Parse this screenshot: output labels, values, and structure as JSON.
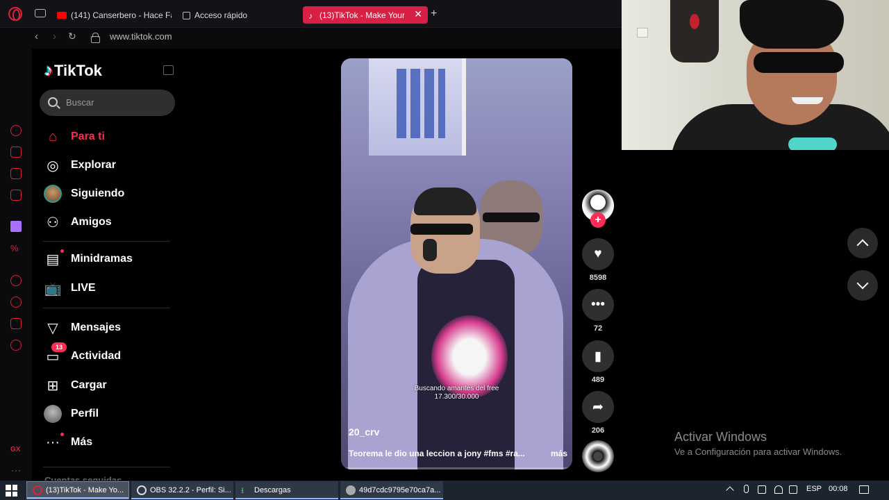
{
  "browser": {
    "tabs": [
      {
        "label": "(141) Canserbero - Hace Fa",
        "favicon": "youtube-icon"
      },
      {
        "label": "Acceso rápido",
        "favicon": "grid-icon"
      },
      {
        "label": "(13)TikTok - Make Your",
        "favicon": "tiktok-icon",
        "active": true
      }
    ],
    "url": "www.tiktok.com",
    "accent_color": "#d81f44"
  },
  "tiktok": {
    "logo_text": "TikTok",
    "search_placeholder": "Buscar",
    "nav": [
      {
        "label": "Para ti",
        "icon": "home-icon",
        "active": true
      },
      {
        "label": "Explorar",
        "icon": "compass-icon"
      },
      {
        "label": "Siguiendo",
        "icon": "avatar"
      },
      {
        "label": "Amigos",
        "icon": "friends-icon"
      },
      {
        "label": "Minidramas",
        "icon": "film-icon"
      },
      {
        "label": "LIVE",
        "icon": "tv-icon"
      },
      {
        "label": "Mensajes",
        "icon": "send-icon"
      },
      {
        "label": "Actividad",
        "icon": "inbox-icon",
        "badge": "13"
      },
      {
        "label": "Cargar",
        "icon": "plus-square-icon"
      },
      {
        "label": "Perfil",
        "icon": "avatar"
      },
      {
        "label": "Más",
        "icon": "more-icon"
      }
    ],
    "more_heading": "Cuentas seguidas",
    "brand_color": "#fe2c55"
  },
  "video": {
    "overlay_line1": "Buscando amantes del free",
    "overlay_line2": "17.300/30.000",
    "username": "20_crv",
    "description": "Teorema le dio una leccion a jony #fms #ra...",
    "more_label": "más"
  },
  "actions": {
    "likes": "8598",
    "comments": "72",
    "saves": "489",
    "shares": "206"
  },
  "watermark": {
    "title": "Activar Windows",
    "subtitle": "Ve a Configuración para activar Windows."
  },
  "taskbar": {
    "items": [
      {
        "label": "(13)TikTok - Make Yo...",
        "icon": "opera-icon",
        "active": true
      },
      {
        "label": "OBS 32.2.2 - Perfil: Si...",
        "icon": "obs-icon"
      },
      {
        "label": "Descargas",
        "icon": "download-icon"
      },
      {
        "label": "49d7cdc9795e70ca7a...",
        "icon": "app-icon"
      }
    ],
    "language": "ESP",
    "time": "00:08"
  }
}
